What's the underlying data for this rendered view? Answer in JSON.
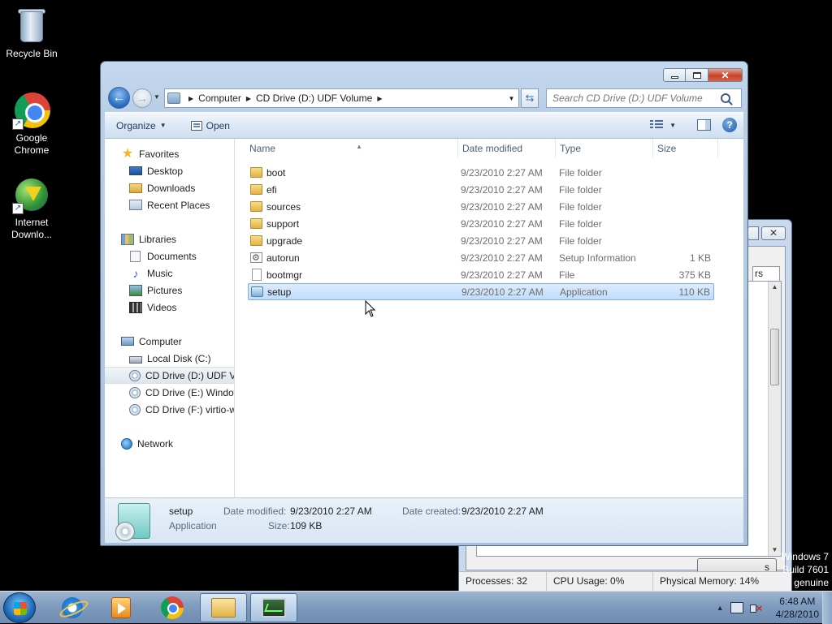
{
  "desktop": {
    "icons": [
      {
        "label": "Recycle Bin"
      },
      {
        "label": "Google Chrome"
      },
      {
        "label": "Internet Downlo..."
      }
    ],
    "watermark": [
      "Windows 7",
      "Build 7601",
      "genuine"
    ]
  },
  "background_window": {
    "tab_fragment": "rs",
    "status": {
      "processes": "Processes: 32",
      "cpu": "CPU Usage: 0%",
      "memory": "Physical Memory: 14%"
    }
  },
  "explorer": {
    "address": {
      "crumbs": [
        "Computer",
        "CD Drive (D:) UDF Volume"
      ]
    },
    "search": {
      "placeholder": "Search CD Drive (D:) UDF Volume"
    },
    "toolbar": {
      "organize": "Organize",
      "open": "Open"
    },
    "nav": {
      "favorites": "Favorites",
      "desktop": "Desktop",
      "downloads": "Downloads",
      "recent": "Recent Places",
      "libraries": "Libraries",
      "documents": "Documents",
      "music": "Music",
      "pictures": "Pictures",
      "videos": "Videos",
      "computer": "Computer",
      "local_disk": "Local Disk (C:)",
      "cd_d": "CD Drive (D:) UDF Volume",
      "cd_e": "CD Drive (E:) Windows",
      "cd_f": "CD Drive (F:) virtio-win",
      "network": "Network"
    },
    "columns": {
      "name": "Name",
      "date": "Date modified",
      "type": "Type",
      "size": "Size"
    },
    "files": [
      {
        "name": "boot",
        "date": "9/23/2010 2:27 AM",
        "type": "File folder",
        "size": "",
        "icon": "folder-icon"
      },
      {
        "name": "efi",
        "date": "9/23/2010 2:27 AM",
        "type": "File folder",
        "size": "",
        "icon": "folder-icon"
      },
      {
        "name": "sources",
        "date": "9/23/2010 2:27 AM",
        "type": "File folder",
        "size": "",
        "icon": "folder-icon"
      },
      {
        "name": "support",
        "date": "9/23/2010 2:27 AM",
        "type": "File folder",
        "size": "",
        "icon": "folder-icon"
      },
      {
        "name": "upgrade",
        "date": "9/23/2010 2:27 AM",
        "type": "File folder",
        "size": "",
        "icon": "folder-icon"
      },
      {
        "name": "autorun",
        "date": "9/23/2010 2:27 AM",
        "type": "Setup Information",
        "size": "1 KB",
        "icon": "setup-info-icon"
      },
      {
        "name": "bootmgr",
        "date": "9/23/2010 2:27 AM",
        "type": "File",
        "size": "375 KB",
        "icon": "file-icon"
      },
      {
        "name": "setup",
        "date": "9/23/2010 2:27 AM",
        "type": "Application",
        "size": "110 KB",
        "icon": "application-icon"
      }
    ],
    "details": {
      "name": "setup",
      "kind": "Application",
      "date_modified_label": "Date modified:",
      "date_modified": "9/23/2010 2:27 AM",
      "size_label": "Size:",
      "size": "109 KB",
      "date_created_label": "Date created:",
      "date_created": "9/23/2010 2:27 AM"
    }
  },
  "taskbar": {
    "clock_time": "6:48 AM",
    "clock_date": "4/28/2010"
  }
}
